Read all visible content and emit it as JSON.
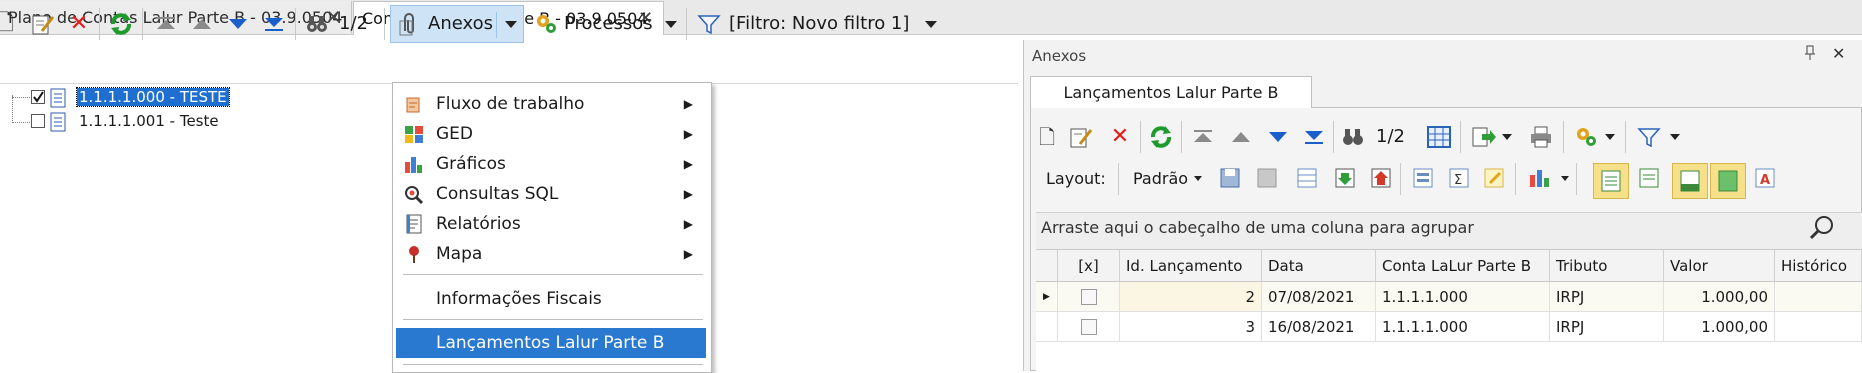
{
  "tabs": [
    {
      "label": "Plano de Contas Lalur Parte B - 03.9.0504",
      "close": "✕"
    },
    {
      "label": "Contas do Lalur Parte B - 03.9.0504",
      "close": "✕"
    }
  ],
  "toolbar": {
    "page_counter": "1/2",
    "anexos_label": "Anexos",
    "processos_label": "Processos",
    "filter_label": "[Filtro: Novo filtro 1]"
  },
  "tree": [
    {
      "label": "1.1.1.1.000 - TESTE",
      "checked": true,
      "selected": true
    },
    {
      "label": "1.1.1.1.001 - Teste",
      "checked": false,
      "selected": false
    }
  ],
  "menu": {
    "items": [
      {
        "label": "Fluxo de trabalho",
        "icon": "workflow-icon",
        "submenu": true
      },
      {
        "label": "GED",
        "icon": "ged-icon",
        "submenu": true
      },
      {
        "label": "Gráficos",
        "icon": "chart-icon",
        "submenu": true
      },
      {
        "label": "Consultas SQL",
        "icon": "sql-query-icon",
        "submenu": true
      },
      {
        "label": "Relatórios",
        "icon": "report-icon",
        "submenu": true
      },
      {
        "label": "Mapa",
        "icon": "map-pin-icon",
        "submenu": true
      }
    ],
    "fiscal": "Informações Fiscais",
    "lancamentos": "Lançamentos Lalur Parte B"
  },
  "panel": {
    "title": "Anexos",
    "pin": "📌",
    "close": "✕",
    "tab_label": "Lançamentos Lalur Parte B",
    "page_counter": "1/2",
    "layout_label": "Layout:",
    "padrao_label": "Padrão",
    "group_hint": "Arraste aqui o cabeçalho de uma coluna para agrupar",
    "columns": [
      "[x]",
      "Id. Lançamento",
      "Data",
      "Conta LaLur Parte B",
      "Tributo",
      "Valor",
      "Histórico"
    ],
    "rows": [
      {
        "id": "2",
        "data": "07/08/2021",
        "conta": "1.1.1.1.000",
        "tributo": "IRPJ",
        "valor": "1.000,00",
        "historico": ""
      },
      {
        "id": "3",
        "data": "16/08/2021",
        "conta": "1.1.1.1.000",
        "tributo": "IRPJ",
        "valor": "1.000,00",
        "historico": ""
      }
    ]
  },
  "colors": {
    "accent": "#2a79d0",
    "selection": "#1e6fd0",
    "highlight": "#cfe3f7"
  }
}
